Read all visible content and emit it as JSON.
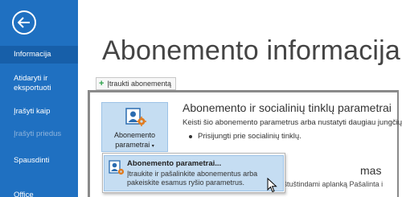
{
  "sidebar": {
    "items": [
      {
        "label": "Informacija"
      },
      {
        "label": "Atidaryti ir eksportuoti"
      },
      {
        "label": "Įrašyti kaip"
      },
      {
        "label": "Įrašyti priedus"
      },
      {
        "label": "Spausdinti"
      },
      {
        "label": "Office"
      }
    ]
  },
  "main": {
    "title": "Abonemento informacija",
    "add_subscription_label": "Įtraukti abonementą",
    "tile_label_line1": "Abonemento",
    "tile_label_line2": "parametrai",
    "section_title": "Abonemento ir socialinių tinklų parametrai",
    "section_desc": "Keisti šio abonemento parametrus arba nustatyti daugiau jungčių.",
    "bullet_text": "Prisijungti prie socialinių tinklų.",
    "bg_heading_fragment": "mas",
    "bg_text_fragment": "oty ištuštindami aplanką Pašalinta i"
  },
  "dropdown": {
    "item_title": "Abonemento parametrai...",
    "item_desc_line1": "Įtraukite ir pašalinkite abonementus arba",
    "item_desc_line2": "pakeiskite esamus ryšio parametrus."
  },
  "colors": {
    "sidebar_bg": "#1f70c1",
    "sidebar_active": "#175fa9",
    "tile_bg": "#c5ddf2"
  }
}
